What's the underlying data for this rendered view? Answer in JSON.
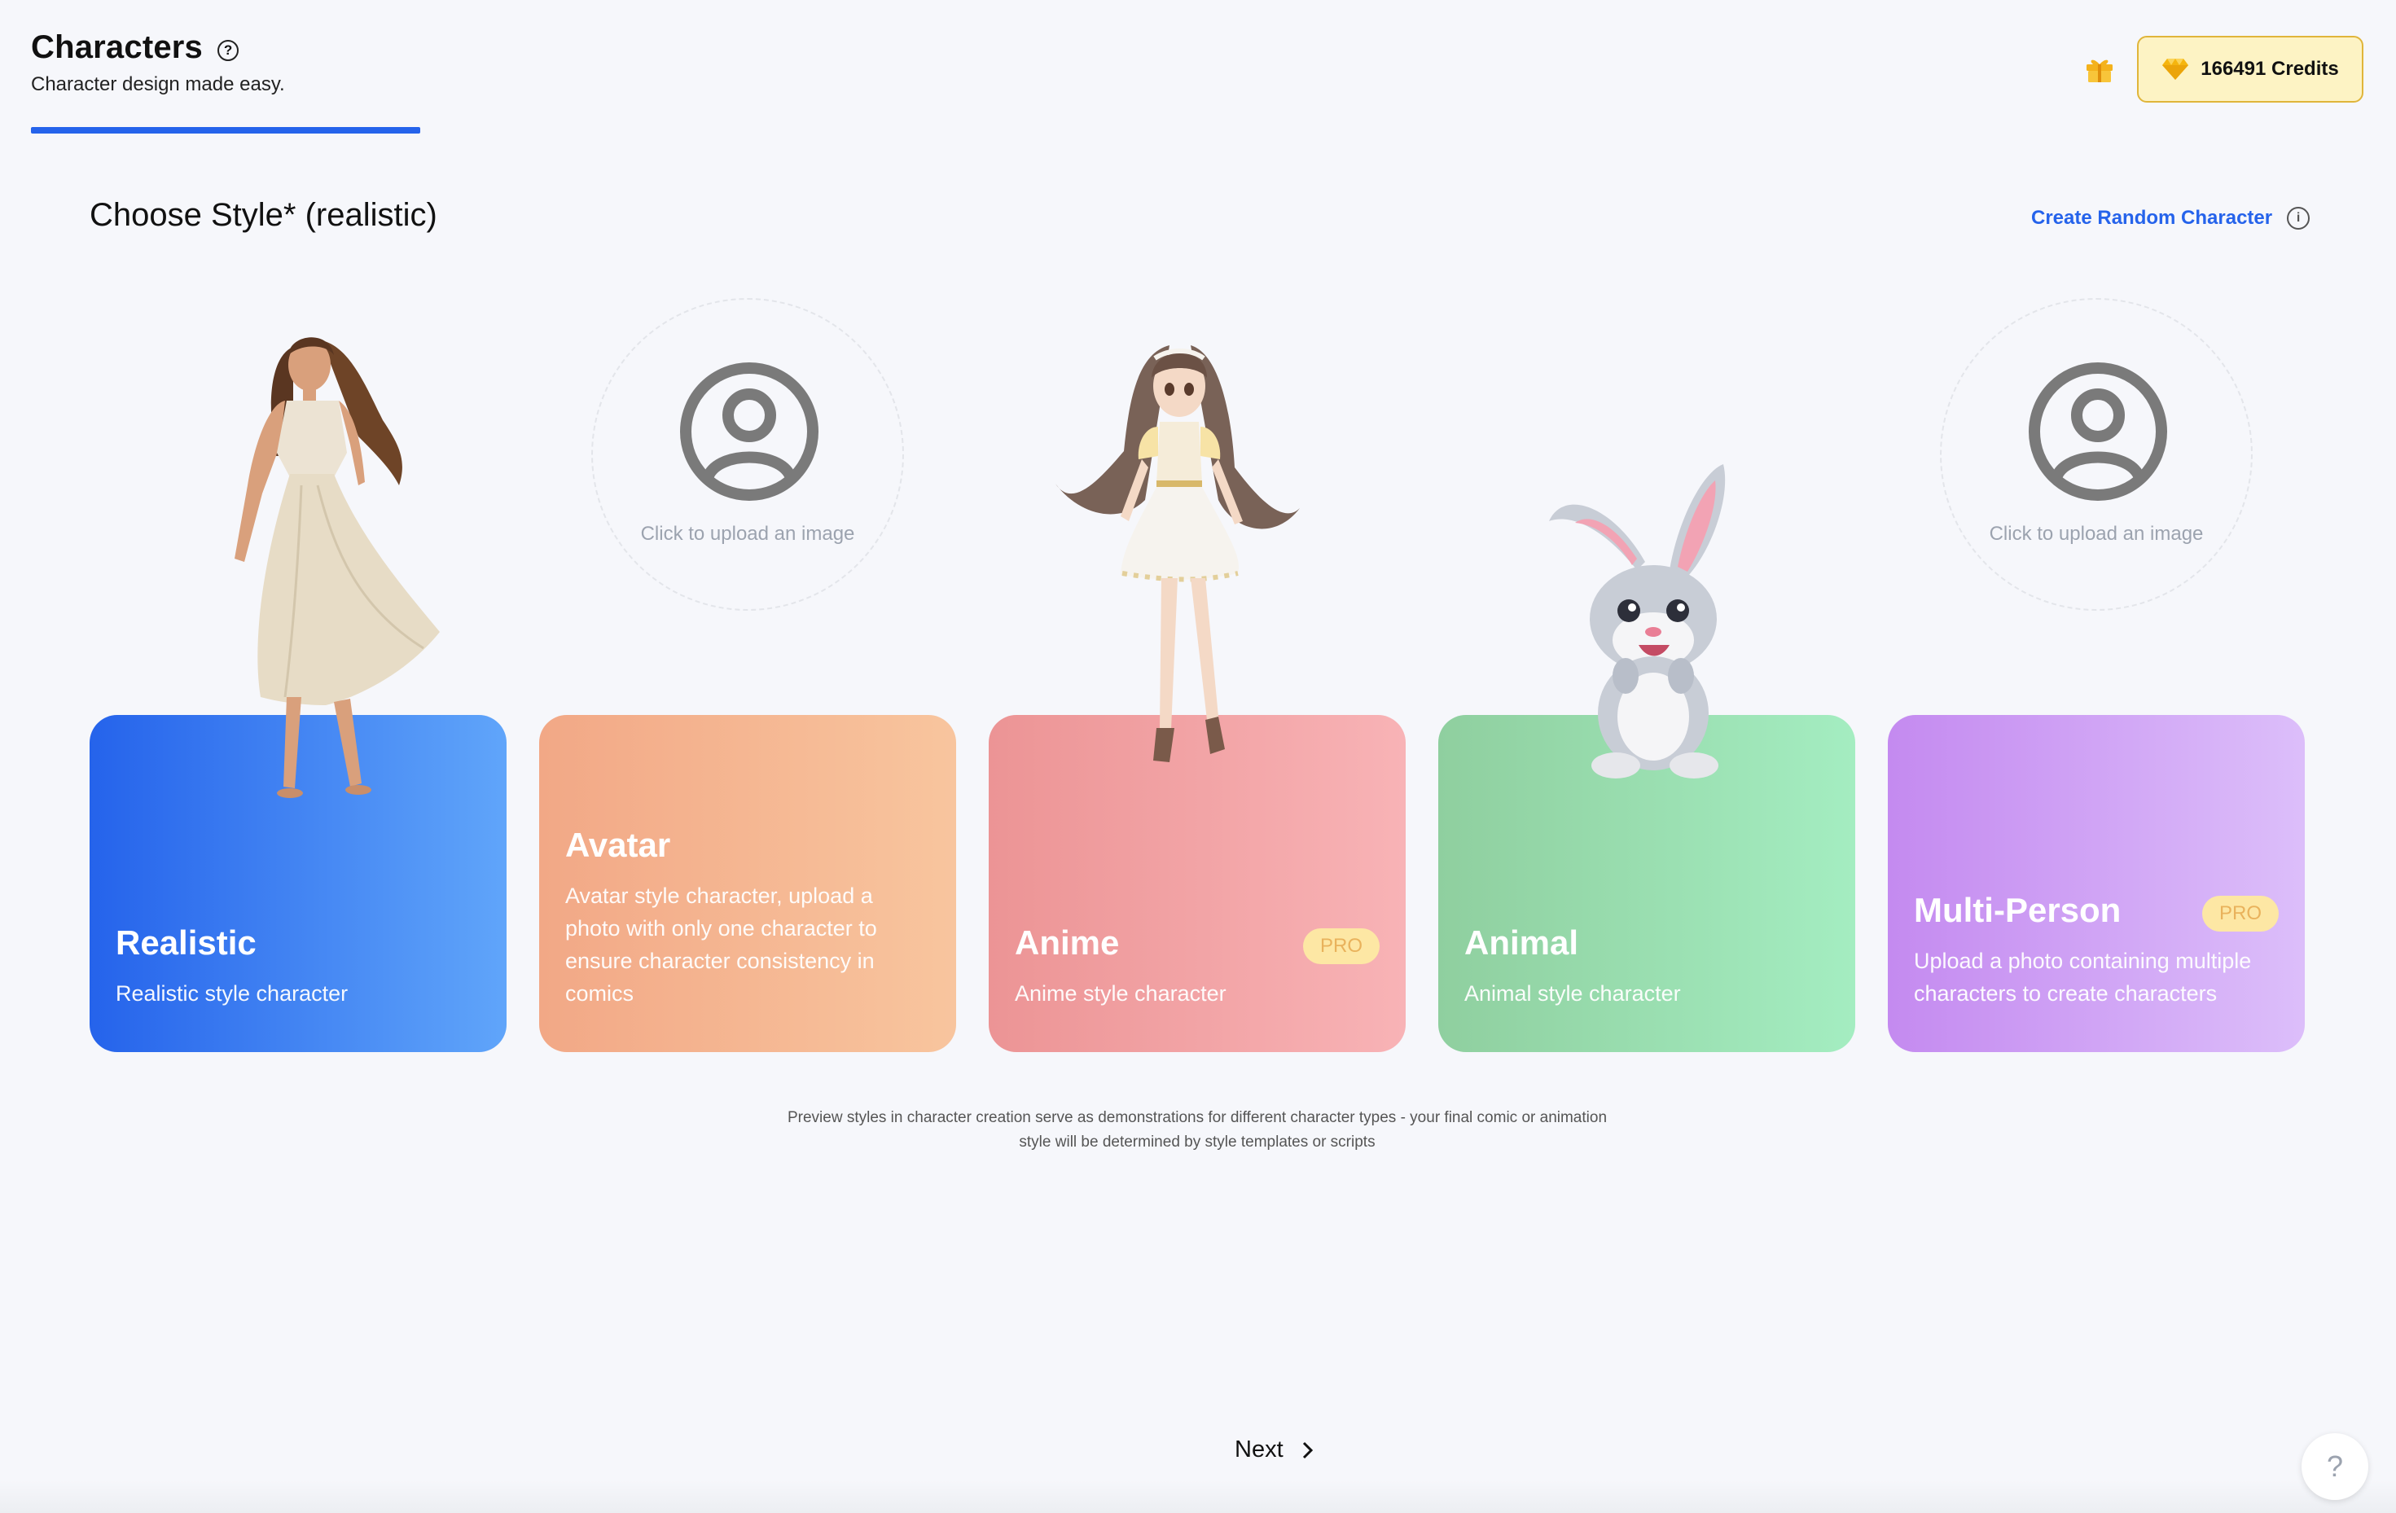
{
  "header": {
    "title": "Characters",
    "subtitle": "Character design made easy.",
    "credits_label": "166491 Credits"
  },
  "section": {
    "title": "Choose Style* (realistic)",
    "random_link": "Create Random Character"
  },
  "upload_placeholder": "Click to upload an image",
  "cards": [
    {
      "title": "Realistic",
      "desc": "Realistic style character"
    },
    {
      "title": "Avatar",
      "desc": "Avatar style character, upload a photo with only one character to ensure character consistency in comics"
    },
    {
      "title": "Anime",
      "desc": "Anime style character",
      "badge": "PRO"
    },
    {
      "title": "Animal",
      "desc": "Animal style character"
    },
    {
      "title": "Multi-Person",
      "desc": "Upload a photo containing multiple characters to create characters",
      "badge": "PRO"
    }
  ],
  "note": "Preview styles in character creation serve as demonstrations for different character types - your final comic or animation style will be determined by style templates or scripts",
  "footer": {
    "next_label": "Next",
    "help_label": "?"
  },
  "colors": {
    "accent": "#2563eb",
    "credits_bg": "#fdf3c4",
    "realistic": "#2563eb",
    "avatar": "#f2a886",
    "anime": "#ec9495",
    "animal": "#8fcf9f",
    "multi": "#c48af0"
  }
}
